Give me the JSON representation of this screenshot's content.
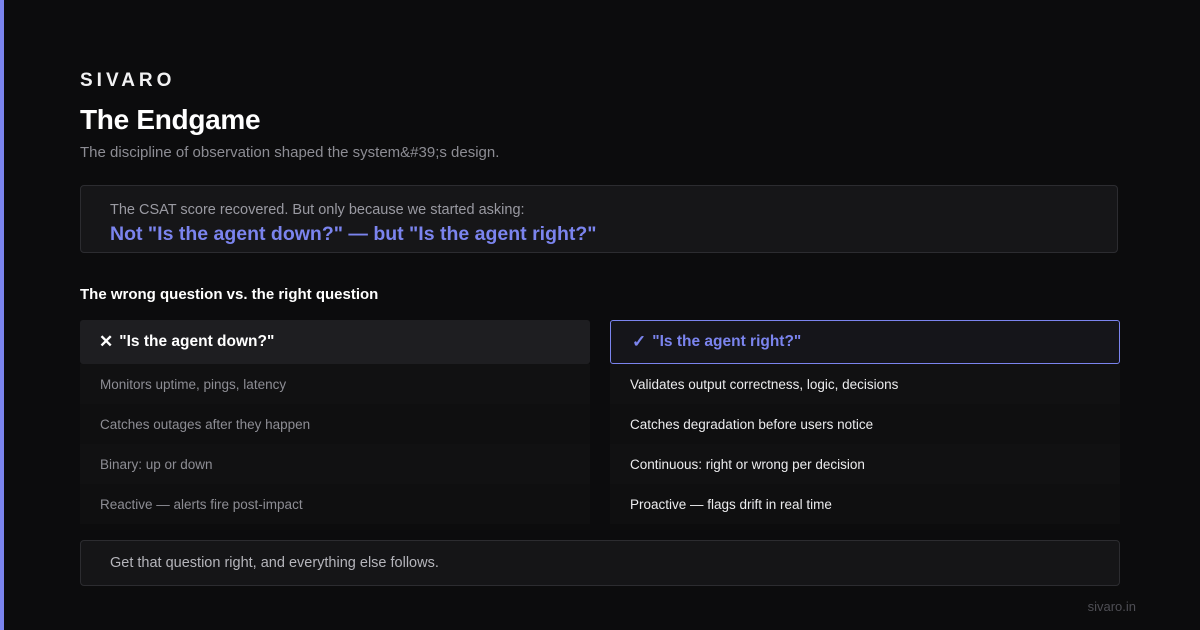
{
  "colors": {
    "accent": "#7b84ee",
    "background": "#0c0c0d"
  },
  "brand": "SIVARO",
  "title": "The Endgame",
  "subtitle": "The discipline of observation shaped the system&#39;s design.",
  "callout": {
    "lead": "The CSAT score recovered. But only because we started asking:",
    "quote": "Not \"Is the agent down?\" — but \"Is the agent right?\""
  },
  "comparison": {
    "heading": "The wrong question vs. the right question",
    "wrong": {
      "icon": "x-icon",
      "mark": "✕",
      "label": "\"Is the agent down?\"",
      "items": [
        "Monitors uptime, pings, latency",
        "Catches outages after they happen",
        "Binary: up or down",
        "Reactive — alerts fire post-impact"
      ]
    },
    "right": {
      "icon": "check-icon",
      "mark": "✓",
      "label": "\"Is the agent right?\"",
      "items": [
        "Validates output correctness, logic, decisions",
        "Catches degradation before users notice",
        "Continuous: right or wrong per decision",
        "Proactive — flags drift in real time"
      ]
    }
  },
  "footer": {
    "message": "Get that question right, and everything else follows.",
    "url": "sivaro.in"
  }
}
